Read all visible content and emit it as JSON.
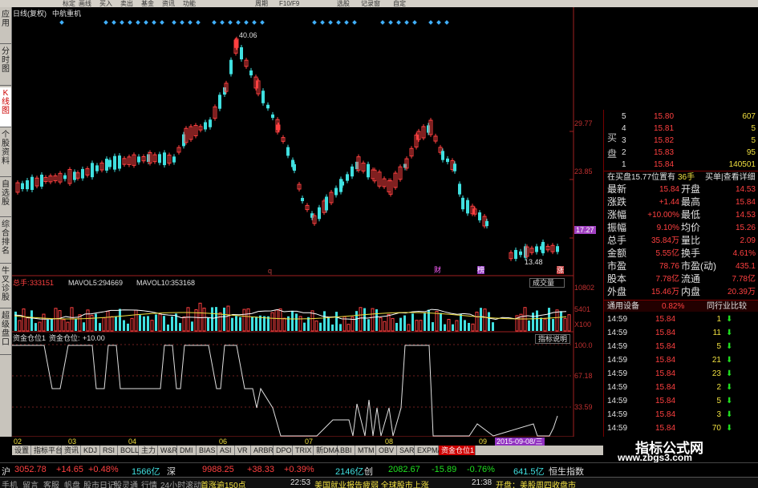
{
  "top_menu": [
    "标定",
    "画线",
    "买入",
    "卖出",
    "基金",
    "资讯",
    "功能",
    "周期",
    "F10/F9",
    "",
    "选股",
    "记录窗",
    "自定"
  ],
  "left_tabs": [
    "应用",
    "分时图",
    "K线图",
    "个股资料",
    "自选股",
    "综合排名",
    "牛叉诊股",
    "超级盘口"
  ],
  "chart": {
    "title": "日线(复权)",
    "stock_name": "中航重机",
    "high_label": "40.06",
    "low_label": "13.48",
    "price_axis": [
      "29.77",
      "23.85",
      "17.27"
    ],
    "current_price_box": "17.27",
    "markers": [
      "q",
      "财",
      "榜",
      "涨"
    ],
    "volume_header": {
      "label": "总手:",
      "total": "333151",
      "ma5_label": "MAVOL5:",
      "ma5": "294669",
      "ma10_label": "MAVOL10:",
      "ma10": "353168"
    },
    "volume_dropdown": "成交量",
    "volume_axis": [
      "10802",
      "5401",
      "X100"
    ],
    "indicator_header": {
      "name": "资金仓位1",
      "label": "资金仓位:",
      "value": "+10.00"
    },
    "indicator_button": "指标说明",
    "indicator_axis": [
      "100.0",
      "67.18",
      "33.59"
    ],
    "x_axis": [
      "02",
      "03",
      "04",
      "05",
      "06",
      "07",
      "08",
      "09"
    ],
    "date_tag": "2015-09-08/三"
  },
  "order_book": [
    {
      "side": "卖",
      "level": "5",
      "price": "15.80",
      "vol": "607"
    },
    {
      "side": "",
      "level": "4",
      "price": "15.81",
      "vol": "5"
    },
    {
      "side": "",
      "level": "3",
      "price": "15.82",
      "vol": "5"
    },
    {
      "side": "",
      "level": "2",
      "price": "15.83",
      "vol": "95"
    },
    {
      "side": "买",
      "level": "1",
      "price": "15.84",
      "vol": "140501"
    }
  ],
  "order_book_side_labels": [
    "买",
    "盘"
  ],
  "queue": {
    "text": "在买盘15.77位置有",
    "count": "36手",
    "link": "买单|查看详细"
  },
  "quote": [
    {
      "l": "最新",
      "v": "15.84",
      "l2": "开盘",
      "v2": "14.53"
    },
    {
      "l": "涨跌",
      "v": "+1.44",
      "l2": "最高",
      "v2": "15.84"
    },
    {
      "l": "涨幅",
      "v": "+10.00%",
      "l2": "最低",
      "v2": "14.53"
    },
    {
      "l": "振幅",
      "v": "9.10%",
      "l2": "均价",
      "v2": "15.26"
    },
    {
      "l": "总手",
      "v": "35.84万",
      "l2": "量比",
      "v2": "2.09"
    },
    {
      "l": "金额",
      "v": "5.55亿",
      "l2": "换手",
      "v2": "4.61%"
    },
    {
      "l": "市盈",
      "v": "78.76",
      "l2": "市盈(动)",
      "v2": "435.1"
    },
    {
      "l": "股本",
      "v": "7.78亿",
      "l2": "流通",
      "v2": "7.78亿"
    },
    {
      "l": "外盘",
      "v": "15.46万",
      "l2": "内盘",
      "v2": "20.39万"
    }
  ],
  "industry": {
    "name": "通用设备",
    "pct": "0.82%",
    "btn": "同行业比较"
  },
  "trades": [
    {
      "t": "14:59",
      "p": "15.84",
      "v": "1"
    },
    {
      "t": "14:59",
      "p": "15.84",
      "v": "11"
    },
    {
      "t": "14:59",
      "p": "15.84",
      "v": "5"
    },
    {
      "t": "14:59",
      "p": "15.84",
      "v": "21"
    },
    {
      "t": "14:59",
      "p": "15.84",
      "v": "23"
    },
    {
      "t": "14:59",
      "p": "15.84",
      "v": "2"
    },
    {
      "t": "14:59",
      "p": "15.84",
      "v": "5"
    },
    {
      "t": "14:59",
      "p": "15.84",
      "v": "3"
    },
    {
      "t": "14:59",
      "p": "15.84",
      "v": "70"
    }
  ],
  "bottom_tabs": [
    "设置",
    "指标平台",
    "资讯",
    "KDJ",
    "RSI",
    "BOLL",
    "主力",
    "W&R",
    "DMI",
    "BIAS",
    "ASI",
    "VR",
    "ARBR",
    "DPO",
    "TRIX",
    "新DMA",
    "BBI",
    "MTM",
    "OBV",
    "SAR",
    "EXPMA",
    "资金仓位1"
  ],
  "ticker": {
    "sh_label": "沪",
    "sh": "3052.78",
    "sh_chg": "+14.65",
    "sh_pct": "+0.48%",
    "sh_amt": "1566亿",
    "sz_label": "深",
    "sz": "9988.25",
    "sz_chg": "+38.33",
    "sz_pct": "+0.39%",
    "sz_amt": "2146亿",
    "cy_label": "创",
    "cy": "2082.67",
    "cy_chg": "-15.89",
    "cy_pct": "-0.76%",
    "cy_amt": "641.5亿",
    "hk": "恒生指数"
  },
  "status": [
    "手机",
    "留言",
    "客服",
    "帆盘",
    "股市日记",
    "股灵通",
    "行情",
    "24小时滚动",
    "首涨逾150点",
    "22:53",
    "美国就业报告疲弱 全球股市上涨",
    "21:38",
    "开盘：美股周四收盘市"
  ],
  "watermark": {
    "title": "指标公式网",
    "url": "www.zbgs3.com"
  },
  "colors": {
    "up": "#ff4040",
    "down": "#40e0e0",
    "axis": "#c03030",
    "bg": "#000000"
  }
}
